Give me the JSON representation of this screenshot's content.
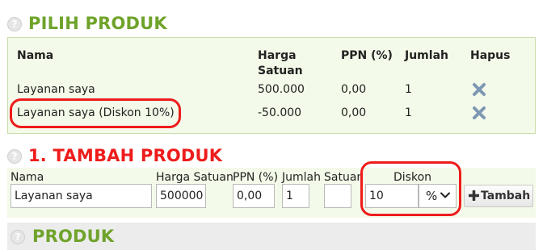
{
  "sections": {
    "selected": {
      "title": "PILIH PRODUK",
      "help": "?"
    },
    "add": {
      "title": "1. TAMBAH PRODUK",
      "help": "?"
    },
    "products": {
      "title": "PRODUK",
      "help": "?"
    }
  },
  "table": {
    "headers": {
      "name": "Nama",
      "price_line1": "Harga",
      "price_line2": "Satuan",
      "ppn": "PPN (%)",
      "qty": "Jumlah",
      "delete": "Hapus"
    },
    "rows": [
      {
        "name": "Layanan saya",
        "price": "500.000",
        "ppn": "0,00",
        "qty": "1"
      },
      {
        "name": "Layanan saya (Diskon 10%)",
        "price": "-50.000",
        "ppn": "0,00",
        "qty": "1"
      }
    ]
  },
  "form": {
    "labels": {
      "name": "Nama",
      "price": "Harga Satuan",
      "ppn": "PPN (%)",
      "qty": "Jumlah",
      "unit": "Satuan",
      "discount": "Diskon"
    },
    "values": {
      "name": "Layanan saya",
      "price": "500000",
      "ppn": "0,00",
      "qty": "1",
      "unit": "",
      "discount": "10",
      "discount_type": "%"
    },
    "add_button": "Tambah"
  },
  "colors": {
    "section_green": "#6fa32b",
    "section_red": "#ee1c1c",
    "delete_icon": "#7d98b3",
    "annotation": "#ee1c1c"
  },
  "icons": {
    "help": "question-circle-icon",
    "delete": "x-icon",
    "add": "plus-icon",
    "dropdown": "chevron-down-icon"
  }
}
